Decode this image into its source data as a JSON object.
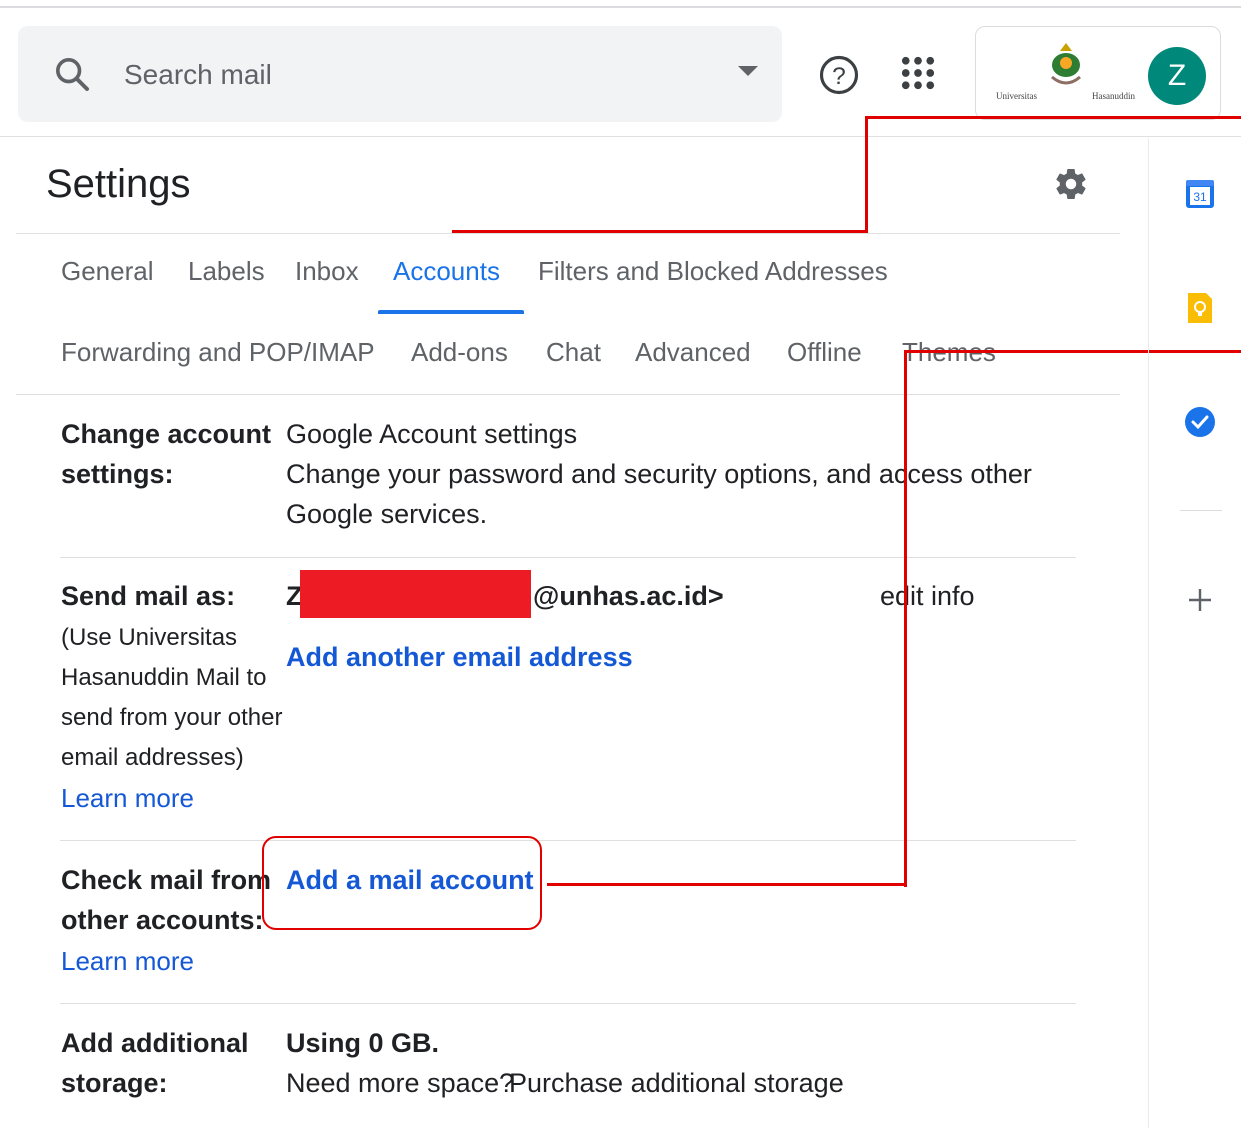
{
  "search": {
    "placeholder": "Search mail"
  },
  "header": {
    "avatar_letter": "Z",
    "logo_text_left": "Universitas",
    "logo_text_right": "Hasanuddin"
  },
  "page_title": "Settings",
  "tabs_row1": [
    "General",
    "Labels",
    "Inbox",
    "Accounts",
    "Filters and Blocked Addresses"
  ],
  "tabs_row2": [
    "Forwarding and POP/IMAP",
    "Add-ons",
    "Chat",
    "Advanced",
    "Offline",
    "Themes"
  ],
  "active_tab": "Accounts",
  "change_account": {
    "label_line1": "Change account",
    "label_line2": "settings:",
    "link": "Google Account settings",
    "desc_line1": "Change your password and security options, and access other",
    "desc_line2": "Google services."
  },
  "send_mail": {
    "label": "Send mail as:",
    "sub_lines": [
      "(Use Universitas",
      "Hasanuddin Mail to",
      "send from your other",
      "email addresses)"
    ],
    "learn_more": "Learn more",
    "email_prefix": "Z",
    "email_suffix": "@unhas.ac.id>",
    "edit_info": "edit info",
    "add_address": "Add another email address"
  },
  "check_mail": {
    "label_line1": "Check mail from",
    "label_line2": "other accounts:",
    "learn_more": "Learn more",
    "add_account": "Add a mail account"
  },
  "storage": {
    "label_line1": "Add additional",
    "label_line2": "storage:",
    "usage": "Using 0 GB.",
    "need_more": "Need more space?",
    "purchase": "Purchase additional storage"
  },
  "side_panel": {
    "calendar_day": "31"
  },
  "colors": {
    "accent": "#1a73e8",
    "link": "#1558d6",
    "avatar": "#00897b",
    "annotation": "#e00000",
    "redaction": "#ed1c24"
  }
}
